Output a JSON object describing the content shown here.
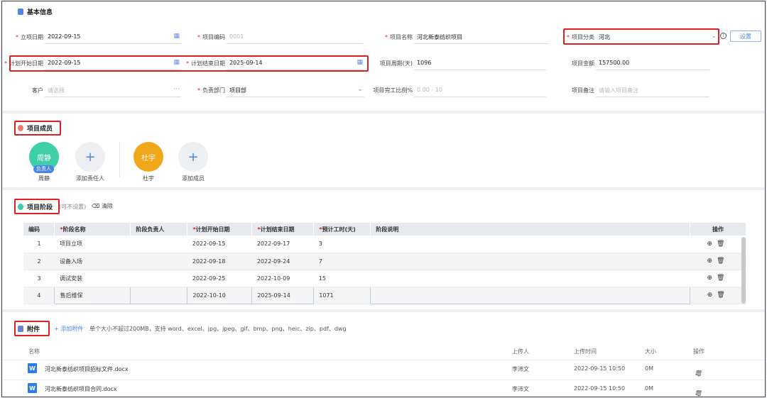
{
  "basic": {
    "title": "基本信息",
    "fields": [
      {
        "key": "start_date",
        "label": "立项日期",
        "required": true,
        "value": "2022-09-15",
        "placeholder": false
      },
      {
        "key": "code",
        "label": "项目编码",
        "required": true,
        "value": "0001",
        "placeholder": true
      },
      {
        "key": "name",
        "label": "项目名称",
        "required": true,
        "value": "河北新泰纺织项目",
        "placeholder": false
      },
      {
        "key": "category",
        "label": "项目分类",
        "required": true,
        "value": "河北",
        "placeholder": false
      },
      {
        "key": "plan_start",
        "label": "计划开始日期",
        "required": true,
        "value": "2022-09-15",
        "placeholder": false
      },
      {
        "key": "plan_end",
        "label": "计划结束日期",
        "required": true,
        "value": "2025-09-14",
        "placeholder": false
      },
      {
        "key": "period",
        "label": "项目周期(天)",
        "required": false,
        "value": "1096",
        "placeholder": false
      },
      {
        "key": "amount",
        "label": "项目金额",
        "required": false,
        "value": "157500.00",
        "placeholder": false
      },
      {
        "key": "customer",
        "label": "客户",
        "required": false,
        "value": "请选择",
        "placeholder": true
      },
      {
        "key": "dept",
        "label": "负责部门",
        "required": true,
        "value": "项目部",
        "placeholder": false
      },
      {
        "key": "ratio",
        "label": "项目完工比例%",
        "required": false,
        "value": "0.00 - 10",
        "placeholder": true
      },
      {
        "key": "remark",
        "label": "项目备注",
        "required": false,
        "value": "请输入项目备注",
        "placeholder": true
      }
    ],
    "settings_button": "设置"
  },
  "members": {
    "title": "项目成员",
    "owner": {
      "avatar_text": "周静",
      "tag": "负责人",
      "name": "周静",
      "color": "#3ecfa9"
    },
    "add_owner_label": "添加责任人",
    "member": {
      "avatar_text": "杜宇",
      "name": "杜宇",
      "color": "#f0a81a"
    },
    "add_member_label": "添加成员",
    "add_symbol": "+"
  },
  "stages": {
    "title": "项目阶段",
    "optional_note": "(可不设置)",
    "clear_label": "清除",
    "columns": [
      "编码",
      "阶段名称",
      "阶段负责人",
      "计划开始日期",
      "计划结束日期",
      "预计工时(天)",
      "阶段说明",
      "操作"
    ],
    "rows": [
      {
        "code": "1",
        "name": "项目立项",
        "owner": "",
        "start": "2022-09-15",
        "end": "2022-09-17",
        "hours": "3",
        "desc": ""
      },
      {
        "code": "2",
        "name": "设备入场",
        "owner": "",
        "start": "2022-09-18",
        "end": "2022-09-24",
        "hours": "7",
        "desc": ""
      },
      {
        "code": "3",
        "name": "调试安装",
        "owner": "",
        "start": "2022-09-25",
        "end": "2022-10-09",
        "hours": "15",
        "desc": ""
      },
      {
        "code": "4",
        "name": "售后维保",
        "owner": "",
        "start": "2022-10-10",
        "end": "2025-09-14",
        "hours": "1071",
        "desc": ""
      }
    ]
  },
  "attachments": {
    "title": "附件",
    "add_label": "+ 添加附件",
    "hint": "单个大小不超过200MB，支持 word、excel、jpg、jpeg、gif、bmp、png、heic、zip、pdf、dwg",
    "columns": [
      "名称",
      "上传人",
      "上传时间",
      "大小",
      "操作"
    ],
    "files": [
      {
        "name": "河北新泰纺织项目招标文件.docx",
        "uploader": "李沛文",
        "time": "2022-09-15 10:50",
        "size": "0M"
      },
      {
        "name": "河北新泰纺织项目合同.docx",
        "uploader": "李沛文",
        "time": "2022-09-15 10:50",
        "size": "0M"
      }
    ]
  },
  "colors": {
    "accent": "#4a86e8",
    "required": "#e02020",
    "highlight": "#e02020"
  }
}
